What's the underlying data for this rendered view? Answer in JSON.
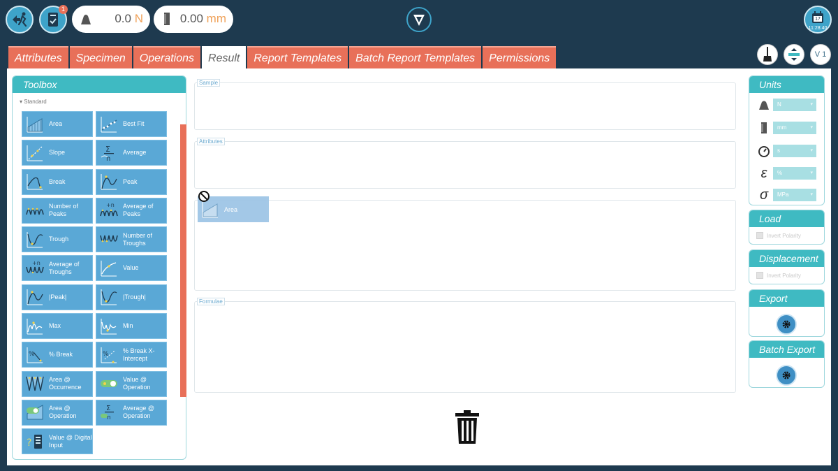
{
  "topbar": {
    "notification_count": "1",
    "load": {
      "value": "0.0",
      "unit": "N"
    },
    "displacement": {
      "value": "0.00",
      "unit": "mm"
    },
    "clock": {
      "day": "17",
      "time": "11:28:40"
    }
  },
  "tabs": [
    {
      "label": "Attributes",
      "active": false
    },
    {
      "label": "Specimen",
      "active": false
    },
    {
      "label": "Operations",
      "active": false
    },
    {
      "label": "Result",
      "active": true
    },
    {
      "label": "Report Templates",
      "active": false
    },
    {
      "label": "Batch Report Templates",
      "active": false
    },
    {
      "label": "Permissions",
      "active": false
    }
  ],
  "right_tools": {
    "version_label": "V 1"
  },
  "toolbox": {
    "title": "Toolbox",
    "section": "Standard",
    "items": [
      "Area",
      "Best Fit",
      "Slope",
      "Average",
      "Break",
      "Peak",
      "Number of Peaks",
      "Average of Peaks",
      "Trough",
      "Number of Troughs",
      "Average of Troughs",
      "Value",
      "|Peak|",
      "|Trough|",
      "Max",
      "Min",
      "% Break",
      "% Break X-Intercept",
      "Area @ Occurrence",
      "Value @ Operation",
      "Area @ Operation",
      "Average @ Operation",
      "Value @ Digital Input"
    ]
  },
  "sections": {
    "sample": "Sample",
    "attributes": "Attributes",
    "formulae": "Formulae"
  },
  "drag_item": {
    "label": "Area"
  },
  "units_panel": {
    "title": "Units",
    "force": "N",
    "length": "mm",
    "time": "s",
    "strain": "%",
    "stress": "MPa"
  },
  "load_panel": {
    "title": "Load",
    "invert_label": "Invert Polarity"
  },
  "displacement_panel": {
    "title": "Displacement",
    "invert_label": "Invert Polarity"
  },
  "export_panel": {
    "title": "Export"
  },
  "batch_export_panel": {
    "title": "Batch Export"
  }
}
